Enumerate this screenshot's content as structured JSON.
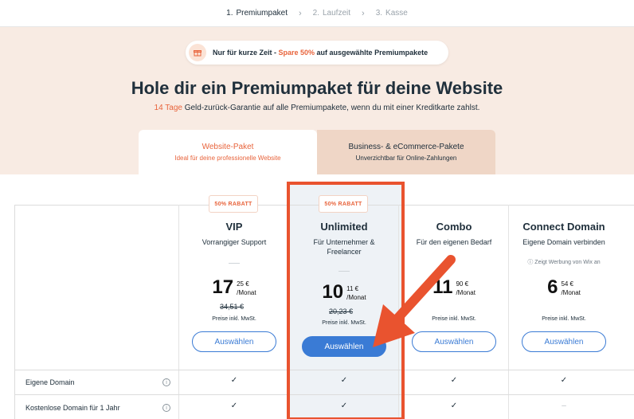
{
  "stepper": {
    "steps": [
      {
        "num": "1.",
        "label": "Premiumpaket"
      },
      {
        "num": "2.",
        "label": "Laufzeit"
      },
      {
        "num": "3.",
        "label": "Kasse"
      }
    ],
    "chevron": "›"
  },
  "promo": {
    "icon": "gift-icon",
    "text_a": "Nur für kurze Zeit",
    "sep": " - ",
    "text_b": "Spare 50%",
    "text_c": " auf ausgewählte Premiumpakete"
  },
  "headline": "Hole dir ein Premiumpaket für deine Website",
  "guarantee": {
    "accent": "14 Tage",
    "rest": " Geld-zurück-Garantie auf alle Premiumpakete, wenn du mit einer Kreditkarte zahlst."
  },
  "tabs": [
    {
      "title": "Website-Paket",
      "subtitle": "Ideal für deine professionelle Website"
    },
    {
      "title": "Business- & eCommerce-Pakete",
      "subtitle": "Unverzichtbar für Online-Zahlungen"
    }
  ],
  "plans": [
    {
      "badge": "50% RABATT",
      "name": "VIP",
      "subtitle": "Vorrangiger Support",
      "price_whole": "17",
      "price_cents": "25 €",
      "per": "/Monat",
      "old_price": "34,51 €",
      "tax_note": "Preise inkl. MwSt.",
      "button": "Auswählen"
    },
    {
      "badge": "50% RABATT",
      "name": "Unlimited",
      "subtitle": "Für Unternehmer & Freelancer",
      "price_whole": "10",
      "price_cents": "11 €",
      "per": "/Monat",
      "old_price": "20,23 €",
      "tax_note": "Preise inkl. MwSt.",
      "button": "Auswählen"
    },
    {
      "name": "Combo",
      "subtitle": "Für den eigenen Bedarf",
      "price_whole": "11",
      "price_cents": "90 €",
      "per": "/Monat",
      "tax_note": "Preise inkl. MwSt.",
      "button": "Auswählen"
    },
    {
      "name": "Connect Domain",
      "subtitle": "Eigene Domain verbinden",
      "ad_note": "ⓘ Zeigt Werbung von Wix an",
      "price_whole": "6",
      "price_cents": "54 €",
      "per": "/Monat",
      "tax_note": "Preise inkl. MwSt.",
      "button": "Auswählen"
    }
  ],
  "features": [
    {
      "label": "Eigene Domain",
      "info": "i",
      "values": [
        "✓",
        "✓",
        "✓",
        "✓"
      ]
    },
    {
      "label": "Kostenlose Domain für 1 Jahr",
      "info": "i",
      "values": [
        "✓",
        "✓",
        "✓",
        "–"
      ]
    }
  ],
  "colors": {
    "accent": "#e8643c",
    "primary": "#3a7bd5",
    "annotation": "#e9532f"
  }
}
